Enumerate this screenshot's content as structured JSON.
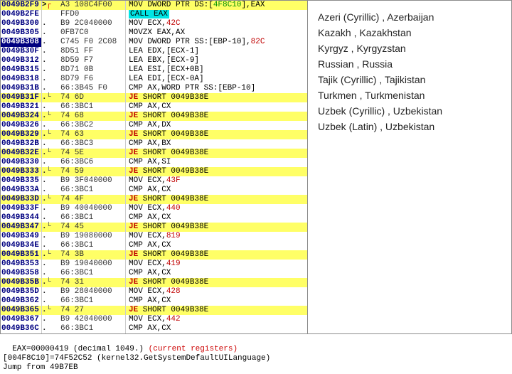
{
  "disasm": [
    {
      "addr": "0049B2F9",
      "mk": ">",
      "arrow": "r",
      "hex": "A3 108C4F00",
      "dis": "MOV DWORD PTR DS:[<g>4F8C10</g>],EAX",
      "hl": "yellow"
    },
    {
      "addr": "0049B2FE",
      "mk": "",
      "arrow": "",
      "hex": "FFD0",
      "dis": "<c>CALL EAX</c>",
      "hl": "cyan"
    },
    {
      "addr": "0049B300",
      "mk": ".",
      "arrow": "",
      "hex": "B9 2C040000",
      "dis": "MOV ECX,<r>42C</r>"
    },
    {
      "addr": "0049B305",
      "mk": ".",
      "arrow": "",
      "hex": "0FB7C0",
      "dis": "MOVZX EAX,AX"
    },
    {
      "addr": "0049B308",
      "mk": ".",
      "arrow": "",
      "hex": "C745 F0 2C08",
      "dis": "MOV DWORD PTR SS:[EBP-10],<r>82C</r>",
      "sel": true
    },
    {
      "addr": "0049B30F",
      "mk": ".",
      "arrow": "",
      "hex": "8D51 FF",
      "dis": "LEA EDX,[ECX-1]"
    },
    {
      "addr": "0049B312",
      "mk": ".",
      "arrow": "",
      "hex": "8D59 F7",
      "dis": "LEA EBX,[ECX-9]"
    },
    {
      "addr": "0049B315",
      "mk": ".",
      "arrow": "",
      "hex": "8D71 0B",
      "dis": "LEA ESI,[ECX+0B]"
    },
    {
      "addr": "0049B318",
      "mk": ".",
      "arrow": "",
      "hex": "8D79 F6",
      "dis": "LEA EDI,[ECX-0A]"
    },
    {
      "addr": "0049B31B",
      "mk": ".",
      "arrow": "",
      "hex": "66:3B45 F0",
      "dis": "CMP AX,WORD PTR SS:[EBP-10]"
    },
    {
      "addr": "0049B31F",
      "mk": ".",
      "arrow": "v",
      "hex": "74 6D",
      "dis": "<j>JE</j> SHORT 0049B38E",
      "hl": "yellow"
    },
    {
      "addr": "0049B321",
      "mk": ".",
      "arrow": "",
      "hex": "66:3BC1",
      "dis": "CMP AX,CX"
    },
    {
      "addr": "0049B324",
      "mk": ".",
      "arrow": "v",
      "hex": "74 68",
      "dis": "<j>JE</j> SHORT 0049B38E",
      "hl": "yellow"
    },
    {
      "addr": "0049B326",
      "mk": ".",
      "arrow": "",
      "hex": "66:3BC2",
      "dis": "CMP AX,DX"
    },
    {
      "addr": "0049B329",
      "mk": ".",
      "arrow": "v",
      "hex": "74 63",
      "dis": "<j>JE</j> SHORT 0049B38E",
      "hl": "yellow"
    },
    {
      "addr": "0049B32B",
      "mk": ".",
      "arrow": "",
      "hex": "66:3BC3",
      "dis": "CMP AX,BX"
    },
    {
      "addr": "0049B32E",
      "mk": ".",
      "arrow": "v",
      "hex": "74 5E",
      "dis": "<j>JE</j> SHORT 0049B38E",
      "hl": "yellow"
    },
    {
      "addr": "0049B330",
      "mk": ".",
      "arrow": "",
      "hex": "66:3BC6",
      "dis": "CMP AX,SI"
    },
    {
      "addr": "0049B333",
      "mk": ".",
      "arrow": "v",
      "hex": "74 59",
      "dis": "<j>JE</j> SHORT 0049B38E",
      "hl": "yellow"
    },
    {
      "addr": "0049B335",
      "mk": ".",
      "arrow": "",
      "hex": "B9 3F040000",
      "dis": "MOV ECX,<r>43F</r>"
    },
    {
      "addr": "0049B33A",
      "mk": ".",
      "arrow": "",
      "hex": "66:3BC1",
      "dis": "CMP AX,CX"
    },
    {
      "addr": "0049B33D",
      "mk": ".",
      "arrow": "v",
      "hex": "74 4F",
      "dis": "<j>JE</j> SHORT 0049B38E",
      "hl": "yellow"
    },
    {
      "addr": "0049B33F",
      "mk": ".",
      "arrow": "",
      "hex": "B9 40040000",
      "dis": "MOV ECX,<r>440</r>"
    },
    {
      "addr": "0049B344",
      "mk": ".",
      "arrow": "",
      "hex": "66:3BC1",
      "dis": "CMP AX,CX"
    },
    {
      "addr": "0049B347",
      "mk": ".",
      "arrow": "v",
      "hex": "74 45",
      "dis": "<j>JE</j> SHORT 0049B38E",
      "hl": "yellow"
    },
    {
      "addr": "0049B349",
      "mk": ".",
      "arrow": "",
      "hex": "B9 19080000",
      "dis": "MOV ECX,<r>819</r>"
    },
    {
      "addr": "0049B34E",
      "mk": ".",
      "arrow": "",
      "hex": "66:3BC1",
      "dis": "CMP AX,CX"
    },
    {
      "addr": "0049B351",
      "mk": ".",
      "arrow": "v",
      "hex": "74 3B",
      "dis": "<j>JE</j> SHORT 0049B38E",
      "hl": "yellow"
    },
    {
      "addr": "0049B353",
      "mk": ".",
      "arrow": "",
      "hex": "B9 19040000",
      "dis": "MOV ECX,<r>419</r>"
    },
    {
      "addr": "0049B358",
      "mk": ".",
      "arrow": "",
      "hex": "66:3BC1",
      "dis": "CMP AX,CX"
    },
    {
      "addr": "0049B35B",
      "mk": ".",
      "arrow": "v",
      "hex": "74 31",
      "dis": "<j>JE</j> SHORT 0049B38E",
      "hl": "yellow"
    },
    {
      "addr": "0049B35D",
      "mk": ".",
      "arrow": "",
      "hex": "B9 28040000",
      "dis": "MOV ECX,<r>428</r>"
    },
    {
      "addr": "0049B362",
      "mk": ".",
      "arrow": "",
      "hex": "66:3BC1",
      "dis": "CMP AX,CX"
    },
    {
      "addr": "0049B365",
      "mk": ".",
      "arrow": "v",
      "hex": "74 27",
      "dis": "<j>JE</j> SHORT 0049B38E",
      "hl": "yellow"
    },
    {
      "addr": "0049B367",
      "mk": ".",
      "arrow": "",
      "hex": "B9 42040000",
      "dis": "MOV ECX,<r>442</r>"
    },
    {
      "addr": "0049B36C",
      "mk": ".",
      "arrow": "",
      "hex": "66:3BC1",
      "dis": "CMP AX,CX"
    }
  ],
  "langs": [
    "Azeri (Cyrillic)  ,  Azerbaijan",
    "Kazakh  ,  Kazakhstan",
    "Kyrgyz  ,  Kyrgyzstan",
    "Russian  ,  Russia",
    "Tajik (Cyrillic)  ,  Tajikistan",
    "Turkmen  ,  Turkmenistan",
    "Uzbek (Cyrillic)  ,  Uzbekistan",
    "Uzbek (Latin)  ,  Uzbekistan"
  ],
  "bottom": {
    "line1a": "EAX=00000419 (decimal 1049.)",
    "line1b": "(current registers)",
    "line2": "[004F8C10]=74F52C52 (kernel32.GetSystemDefaultUILanguage)",
    "line3": "Jump from 49B7EB"
  }
}
